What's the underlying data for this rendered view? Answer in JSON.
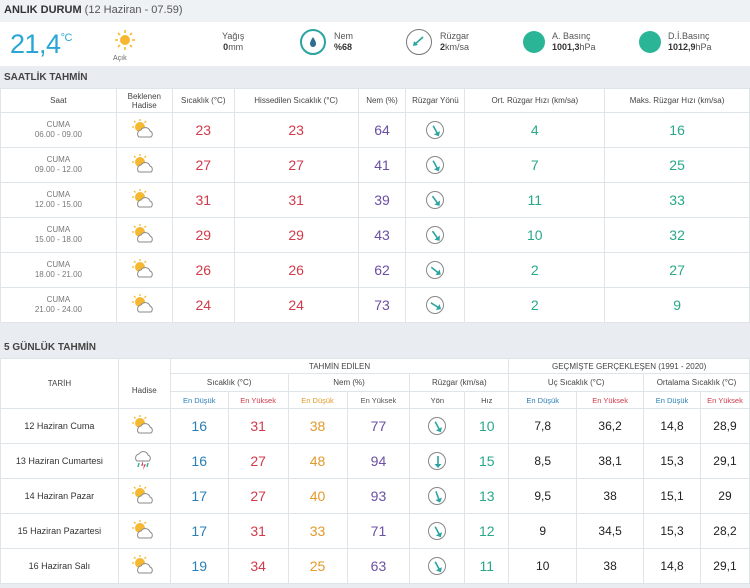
{
  "current": {
    "title": "ANLIK DURUM",
    "timestamp": "(12 Haziran - 07.59)",
    "temperature": "21,4",
    "unit": "°C",
    "sky_label": "Açık",
    "precip_label": "Yağış",
    "precip_value": "0",
    "precip_unit": "mm",
    "humidity_label": "Nem",
    "humidity_value": "%68",
    "wind_label": "Rüzgar",
    "wind_value": "2",
    "wind_unit": "km/sa",
    "pressure_label": "A. Basınç",
    "pressure_value": "1001,3",
    "pressure_unit": "hPa",
    "sea_pressure_label": "D.İ.Basınç",
    "sea_pressure_value": "1012,9",
    "sea_pressure_unit": "hPa"
  },
  "hourly": {
    "title": "SAATLİK TAHMİN",
    "headers": [
      "Saat",
      "Beklenen Hadise",
      "Sıcaklık (°C)",
      "Hissedilen Sıcaklık (°C)",
      "Nem (%)",
      "Rüzgar Yönü",
      "Ort. Rüzgar Hızı (km/sa)",
      "Maks. Rüzgar Hızı (km/sa)"
    ],
    "rows": [
      {
        "day": "CUMA",
        "time": "06.00 - 09.00",
        "temp": "23",
        "feels": "23",
        "hum": "64",
        "avg": "4",
        "max": "16"
      },
      {
        "day": "CUMA",
        "time": "09.00 - 12.00",
        "temp": "27",
        "feels": "27",
        "hum": "41",
        "avg": "7",
        "max": "25"
      },
      {
        "day": "CUMA",
        "time": "12.00 - 15.00",
        "temp": "31",
        "feels": "31",
        "hum": "39",
        "avg": "11",
        "max": "33"
      },
      {
        "day": "CUMA",
        "time": "15.00 - 18.00",
        "temp": "29",
        "feels": "29",
        "hum": "43",
        "avg": "10",
        "max": "32"
      },
      {
        "day": "CUMA",
        "time": "18.00 - 21.00",
        "temp": "26",
        "feels": "26",
        "hum": "62",
        "avg": "2",
        "max": "27"
      },
      {
        "day": "CUMA",
        "time": "21.00 - 24.00",
        "temp": "24",
        "feels": "24",
        "hum": "73",
        "avg": "2",
        "max": "9"
      }
    ]
  },
  "daily": {
    "title": "5 GÜNLÜK TAHMİN",
    "group_forecast": "TAHMİN EDİLEN",
    "group_past": "GEÇMİŞTE GERÇEKLEŞEN (1991 - 2020)",
    "col_date": "TARİH",
    "col_event": "Hadise",
    "col_temp": "Sıcaklık (°C)",
    "col_hum": "Nem (%)",
    "col_wind": "Rüzgar (km/sa)",
    "col_extreme": "Uç Sıcaklık (°C)",
    "col_avg": "Ortalama Sıcaklık (°C)",
    "lo": "En Düşük",
    "hi": "En Yüksek",
    "dir": "Yön",
    "speed": "Hız",
    "rows": [
      {
        "date": "12 Haziran Cuma",
        "tlo": "16",
        "thi": "31",
        "hlo": "38",
        "hhi": "77",
        "wind": "10",
        "elo": "7,8",
        "ehi": "36,2",
        "alo": "14,8",
        "ahi": "28,9"
      },
      {
        "date": "13 Haziran Cumartesi",
        "tlo": "16",
        "thi": "27",
        "hlo": "48",
        "hhi": "94",
        "wind": "15",
        "elo": "8,5",
        "ehi": "38,1",
        "alo": "15,3",
        "ahi": "29,1"
      },
      {
        "date": "14 Haziran Pazar",
        "tlo": "17",
        "thi": "27",
        "hlo": "40",
        "hhi": "93",
        "wind": "13",
        "elo": "9,5",
        "ehi": "38",
        "alo": "15,1",
        "ahi": "29"
      },
      {
        "date": "15 Haziran Pazartesi",
        "tlo": "17",
        "thi": "31",
        "hlo": "33",
        "hhi": "71",
        "wind": "12",
        "elo": "9",
        "ehi": "34,5",
        "alo": "15,3",
        "ahi": "28,2"
      },
      {
        "date": "16 Haziran Salı",
        "tlo": "19",
        "thi": "34",
        "hlo": "25",
        "hhi": "63",
        "wind": "11",
        "elo": "10",
        "ehi": "38",
        "alo": "14,8",
        "ahi": "29,1"
      }
    ]
  }
}
